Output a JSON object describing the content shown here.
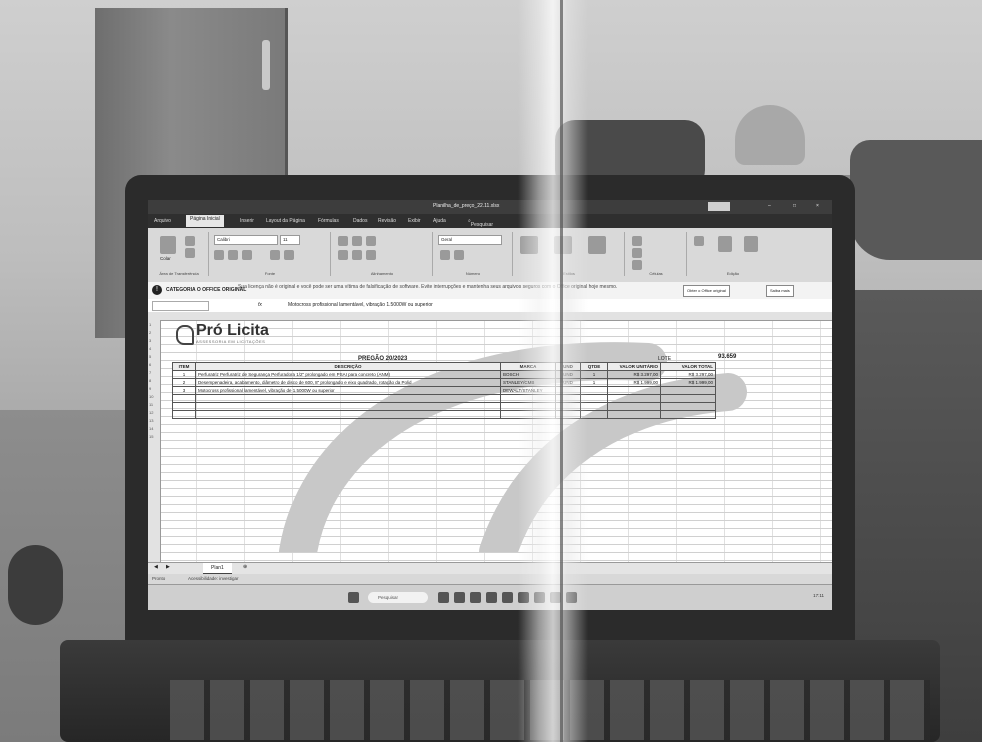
{
  "window": {
    "title": "Planilha_de_preço_22.11.xlsx",
    "search_placeholder": "Pesquisar"
  },
  "ribbon": {
    "tabs": [
      "Arquivo",
      "Página Inicial",
      "Inserir",
      "Layout da Página",
      "Fórmulas",
      "Dados",
      "Revisão",
      "Exibir",
      "Ajuda"
    ],
    "groups": [
      "Área de Transferência",
      "Fonte",
      "Alinhamento",
      "Número",
      "Estilos",
      "Células",
      "Edição"
    ],
    "font_name": "Calibri",
    "font_size": "11",
    "number_format": "Geral",
    "paste_label": "Colar"
  },
  "message_bar": {
    "title": "CATEGORIA O OFFICE ORIGINAL",
    "text": "Sua licença não é original e você pode ser uma vítima de falsificação de software. Evite interrupções e mantenha seus arquivos seguros com o Office original hoje mesmo.",
    "button_1": "Obter o Office original",
    "button_2": "Saiba mais"
  },
  "formula_bar": {
    "fx": "fx",
    "content": "Motocross profissional lamentável, vibração 1.5000W ou superior"
  },
  "sheet": {
    "logo_name": "Pró Licita",
    "logo_tag": "ASSESSORIA EM LICITAÇÕES",
    "title": "PREGÃO 20/2023",
    "label_lote": "LOTE",
    "lote_total": "93.659",
    "headers": [
      "ITEM",
      "DESCRIÇÃO",
      "MARCA",
      "UND",
      "QTDE",
      "VALOR UNITÁRIO",
      "VALOR TOTAL"
    ],
    "rows": [
      {
        "item": "1",
        "desc": "Perfuratriz Perfuratriz de Segurança Perfuradora 1/2\" prolongado em PSAI para concreto (ANM)",
        "marca": "BOSCH",
        "und": "UND",
        "qtd": "1",
        "vu": "R$ 3.297,00",
        "vt": "R$ 3.297,00"
      },
      {
        "item": "2",
        "desc": "Desempenadeira, acabamento, diâmetro de disco de 600, 8\" prolongado e eixo quadrado, rotação da Polid",
        "marca": "STANLEY/CMB",
        "und": "UND",
        "qtd": "1",
        "vu": "R$ 1.999,00",
        "vt": "R$ 1.999,00"
      },
      {
        "item": "3",
        "desc": "Motocross profissional lamentável, vibração de 1.5000W ou superior",
        "marca": "DEWALT/STANLEY",
        "und": "",
        "qtd": "",
        "vu": "",
        "vt": ""
      }
    ],
    "sheet_tab": "Plan1"
  },
  "status_bar": {
    "left": "Pronto",
    "accessibility": "Acessibilidade: investigar"
  },
  "taskbar": {
    "search": "Pesquisar",
    "clock": "17:11"
  }
}
